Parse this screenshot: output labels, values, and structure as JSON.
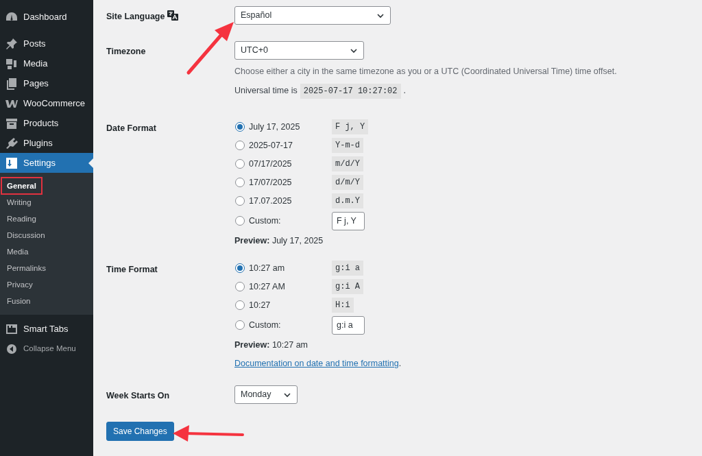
{
  "sidebar": {
    "items": [
      {
        "label": "Dashboard",
        "current": false
      },
      {
        "label": "Posts",
        "current": false
      },
      {
        "label": "Media",
        "current": false
      },
      {
        "label": "Pages",
        "current": false
      },
      {
        "label": "WooCommerce",
        "current": false
      },
      {
        "label": "Products",
        "current": false
      },
      {
        "label": "Plugins",
        "current": false
      },
      {
        "label": "Settings",
        "current": true,
        "children": [
          {
            "label": "General",
            "current": true,
            "highlighted": true
          },
          {
            "label": "Writing",
            "current": false,
            "highlighted": false
          },
          {
            "label": "Reading",
            "current": false,
            "highlighted": false
          },
          {
            "label": "Discussion",
            "current": false,
            "highlighted": false
          },
          {
            "label": "Media",
            "current": false,
            "highlighted": false
          },
          {
            "label": "Permalinks",
            "current": false,
            "highlighted": false
          },
          {
            "label": "Privacy",
            "current": false,
            "highlighted": false
          },
          {
            "label": "Fusion",
            "current": false,
            "highlighted": false
          }
        ]
      },
      {
        "label": "Smart Tabs",
        "current": false
      }
    ],
    "collapse": "Collapse Menu"
  },
  "site_language": {
    "label": "Site Language",
    "value": "Español"
  },
  "timezone": {
    "label": "Timezone",
    "value": "UTC+0",
    "description": "Choose either a city in the same timezone as you or a UTC (Coordinated Universal Time) time offset.",
    "universal_label": "Universal time is",
    "universal_value": "2025-07-17 10:27:02",
    "universal_suffix": "."
  },
  "date_format": {
    "label": "Date Format",
    "options": [
      {
        "label": "July 17, 2025",
        "code": "F j, Y",
        "selected": true,
        "kind": "preset"
      },
      {
        "label": "2025-07-17",
        "code": "Y-m-d",
        "selected": false,
        "kind": "preset"
      },
      {
        "label": "07/17/2025",
        "code": "m/d/Y",
        "selected": false,
        "kind": "preset"
      },
      {
        "label": "17/07/2025",
        "code": "d/m/Y",
        "selected": false,
        "kind": "preset"
      },
      {
        "label": "17.07.2025",
        "code": "d.m.Y",
        "selected": false,
        "kind": "preset"
      },
      {
        "label": "Custom:",
        "value": "F j, Y",
        "selected": false,
        "kind": "custom"
      }
    ],
    "preview_label": "Preview:",
    "preview": "July 17, 2025"
  },
  "time_format": {
    "label": "Time Format",
    "options": [
      {
        "label": "10:27 am",
        "code": "g:i a",
        "selected": true,
        "kind": "preset"
      },
      {
        "label": "10:27 AM",
        "code": "g:i A",
        "selected": false,
        "kind": "preset"
      },
      {
        "label": "10:27",
        "code": "H:i",
        "selected": false,
        "kind": "preset"
      },
      {
        "label": "Custom:",
        "value": "g:i a",
        "selected": false,
        "kind": "custom"
      }
    ],
    "preview_label": "Preview:",
    "preview": "10:27 am",
    "doc_link": "Documentation on date and time formatting",
    "doc_suffix": "."
  },
  "week_starts": {
    "label": "Week Starts On",
    "value": "Monday"
  },
  "save_button": "Save Changes"
}
